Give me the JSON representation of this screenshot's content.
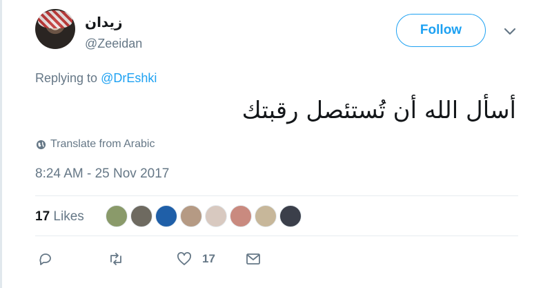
{
  "author": {
    "display_name": "زيدان",
    "handle": "@Zeeidan"
  },
  "follow_label": "Follow",
  "reply": {
    "prefix": "Replying to",
    "mention": "@DrEshki"
  },
  "tweet_text": "أسأل الله أن تُستئصل رقبتك",
  "translate_label": "Translate from Arabic",
  "timestamp": "8:24 AM - 25 Nov 2017",
  "likes": {
    "count": "17",
    "label": "Likes"
  },
  "likers": [
    {
      "name": "liker-1",
      "color": "#8a9a6a"
    },
    {
      "name": "liker-2",
      "color": "#6e6a60"
    },
    {
      "name": "liker-3",
      "color": "#1f5fa8"
    },
    {
      "name": "liker-4",
      "color": "#b59a84"
    },
    {
      "name": "liker-5",
      "color": "#d8c9c0"
    },
    {
      "name": "liker-6",
      "color": "#c98a7f"
    },
    {
      "name": "liker-7",
      "color": "#c7b79a"
    },
    {
      "name": "liker-8",
      "color": "#3b3f4a"
    }
  ],
  "actions": {
    "reply_icon": "reply-icon",
    "retweet_icon": "retweet-icon",
    "like_icon": "heart-icon",
    "like_count": "17",
    "dm_icon": "envelope-icon"
  },
  "colors": {
    "accent": "#1da1f2",
    "secondary_text": "#657786",
    "divider": "#e6ecf0"
  }
}
